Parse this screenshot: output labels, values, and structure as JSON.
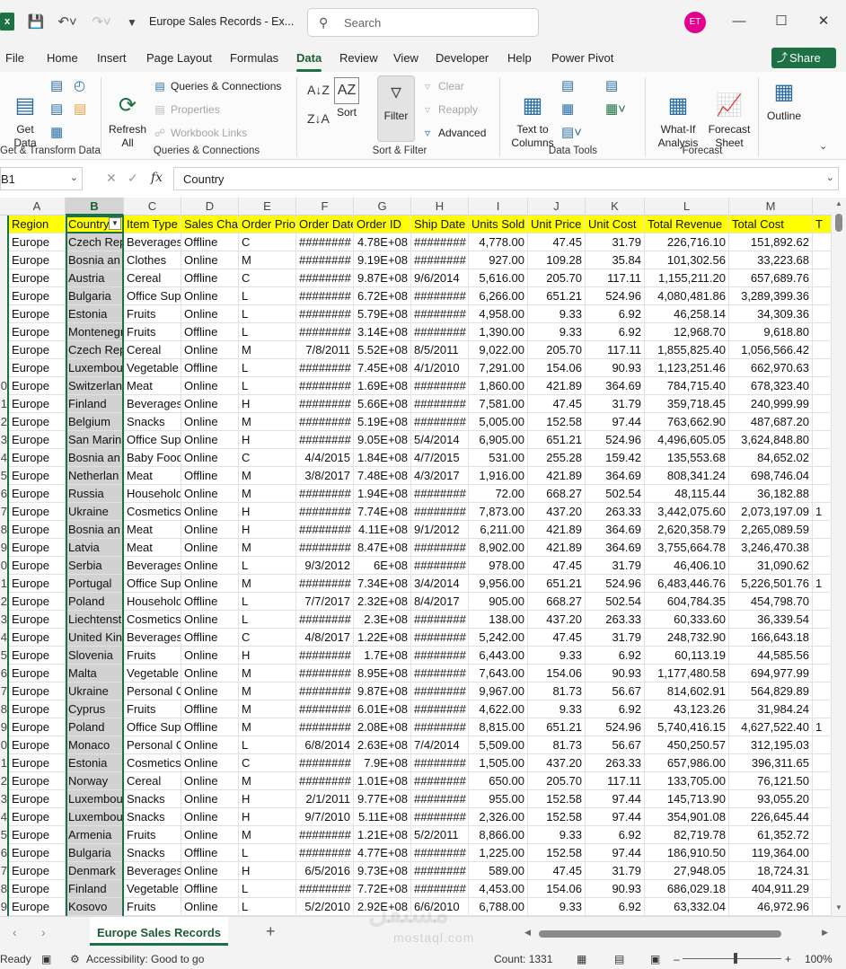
{
  "window": {
    "title": "Europe Sales Records  -  Ex...",
    "search_placeholder": "Search",
    "avatar_initials": "ET",
    "accent_color": "#1e7145"
  },
  "menu": {
    "tabs": [
      "File",
      "Home",
      "Insert",
      "Page Layout",
      "Formulas",
      "Data",
      "Review",
      "View",
      "Developer",
      "Help",
      "Power Pivot"
    ],
    "active": "Data",
    "share_label": "Share"
  },
  "ribbon": {
    "get_data": "Get\nData",
    "refresh_all": "Refresh\nAll",
    "queries_connections": "Queries & Connections",
    "properties": "Properties",
    "workbook_links": "Workbook Links",
    "sort": "Sort",
    "filter": "Filter",
    "clear": "Clear",
    "reapply": "Reapply",
    "advanced": "Advanced",
    "text_to_columns": "Text to\nColumns",
    "what_if": "What-If\nAnalysis",
    "forecast_sheet": "Forecast\nSheet",
    "outline": "Outline",
    "groups": {
      "get_transform": "Get & Transform Data",
      "queries": "Queries & Connections",
      "sort_filter": "Sort & Filter",
      "data_tools": "Data Tools",
      "forecast": "Forecast"
    }
  },
  "formula_bar": {
    "name_box": "B1",
    "fx": "fx",
    "content": "Country"
  },
  "sheet": {
    "column_letters": [
      "A",
      "B",
      "C",
      "D",
      "E",
      "F",
      "G",
      "H",
      "I",
      "J",
      "K",
      "L",
      "M"
    ],
    "selected_column": "B",
    "headers": [
      "Region",
      "Country",
      "Item Type",
      "Sales Channel",
      "Order Priority",
      "Order Date",
      "Order ID",
      "Ship Date",
      "Units Sold",
      "Unit Price",
      "Unit Cost",
      "Total Revenue",
      "Total Cost",
      "T"
    ],
    "row_numbers": [
      "",
      "",
      "",
      "",
      "",
      "",
      "",
      "",
      "",
      "0",
      "1",
      "2",
      "3",
      "4",
      "5",
      "6",
      "7",
      "8",
      "9",
      "0",
      "1",
      "2",
      "3",
      "4",
      "5",
      "6",
      "7",
      "8",
      "9",
      "0",
      "1",
      "2",
      "3",
      "4",
      "5",
      "6",
      "7",
      "8",
      "9"
    ],
    "rows": [
      [
        "Europe",
        "Czech Rep",
        "Beverages",
        "Offline",
        "C",
        "########",
        "4.78E+08",
        "########",
        "4,778.00",
        "47.45",
        "31.79",
        "226,716.10",
        "151,892.62",
        ""
      ],
      [
        "Europe",
        "Bosnia an",
        "Clothes",
        "Online",
        "M",
        "########",
        "9.19E+08",
        "########",
        "927.00",
        "109.28",
        "35.84",
        "101,302.56",
        "33,223.68",
        ""
      ],
      [
        "Europe",
        "Austria",
        "Cereal",
        "Offline",
        "C",
        "########",
        "9.87E+08",
        "9/6/2014",
        "5,616.00",
        "205.70",
        "117.11",
        "1,155,211.20",
        "657,689.76",
        ""
      ],
      [
        "Europe",
        "Bulgaria",
        "Office Sup",
        "Online",
        "L",
        "########",
        "6.72E+08",
        "########",
        "6,266.00",
        "651.21",
        "524.96",
        "4,080,481.86",
        "3,289,399.36",
        ""
      ],
      [
        "Europe",
        "Estonia",
        "Fruits",
        "Online",
        "L",
        "########",
        "5.79E+08",
        "########",
        "4,958.00",
        "9.33",
        "6.92",
        "46,258.14",
        "34,309.36",
        ""
      ],
      [
        "Europe",
        "Montenegr",
        "Fruits",
        "Offline",
        "L",
        "########",
        "3.14E+08",
        "########",
        "1,390.00",
        "9.33",
        "6.92",
        "12,968.70",
        "9,618.80",
        ""
      ],
      [
        "Europe",
        "Czech Rep",
        "Cereal",
        "Online",
        "M",
        "7/8/2011",
        "5.52E+08",
        "8/5/2011",
        "9,022.00",
        "205.70",
        "117.11",
        "1,855,825.40",
        "1,056,566.42",
        ""
      ],
      [
        "Europe",
        "Luxembou",
        "Vegetable",
        "Offline",
        "L",
        "########",
        "7.45E+08",
        "4/1/2010",
        "7,291.00",
        "154.06",
        "90.93",
        "1,123,251.46",
        "662,970.63",
        ""
      ],
      [
        "Europe",
        "Switzerlan",
        "Meat",
        "Online",
        "L",
        "########",
        "1.69E+08",
        "########",
        "1,860.00",
        "421.89",
        "364.69",
        "784,715.40",
        "678,323.40",
        ""
      ],
      [
        "Europe",
        "Finland",
        "Beverages",
        "Online",
        "H",
        "########",
        "5.66E+08",
        "########",
        "7,581.00",
        "47.45",
        "31.79",
        "359,718.45",
        "240,999.99",
        ""
      ],
      [
        "Europe",
        "Belgium",
        "Snacks",
        "Online",
        "M",
        "########",
        "5.19E+08",
        "########",
        "5,005.00",
        "152.58",
        "97.44",
        "763,662.90",
        "487,687.20",
        ""
      ],
      [
        "Europe",
        "San Marin",
        "Office Sup",
        "Online",
        "H",
        "########",
        "9.05E+08",
        "5/4/2014",
        "6,905.00",
        "651.21",
        "524.96",
        "4,496,605.05",
        "3,624,848.80",
        ""
      ],
      [
        "Europe",
        "Bosnia an",
        "Baby Food",
        "Online",
        "C",
        "4/4/2015",
        "1.84E+08",
        "4/7/2015",
        "531.00",
        "255.28",
        "159.42",
        "135,553.68",
        "84,652.02",
        ""
      ],
      [
        "Europe",
        "Netherlan",
        "Meat",
        "Offline",
        "M",
        "3/8/2017",
        "7.48E+08",
        "4/3/2017",
        "1,916.00",
        "421.89",
        "364.69",
        "808,341.24",
        "698,746.04",
        ""
      ],
      [
        "Europe",
        "Russia",
        "Household",
        "Online",
        "M",
        "########",
        "1.94E+08",
        "########",
        "72.00",
        "668.27",
        "502.54",
        "48,115.44",
        "36,182.88",
        ""
      ],
      [
        "Europe",
        "Ukraine",
        "Cosmetics",
        "Online",
        "H",
        "########",
        "7.74E+08",
        "########",
        "7,873.00",
        "437.20",
        "263.33",
        "3,442,075.60",
        "2,073,197.09",
        "1"
      ],
      [
        "Europe",
        "Bosnia an",
        "Meat",
        "Online",
        "H",
        "########",
        "4.11E+08",
        "9/1/2012",
        "6,211.00",
        "421.89",
        "364.69",
        "2,620,358.79",
        "2,265,089.59",
        ""
      ],
      [
        "Europe",
        "Latvia",
        "Meat",
        "Online",
        "M",
        "########",
        "8.47E+08",
        "########",
        "8,902.00",
        "421.89",
        "364.69",
        "3,755,664.78",
        "3,246,470.38",
        ""
      ],
      [
        "Europe",
        "Serbia",
        "Beverages",
        "Online",
        "L",
        "9/3/2012",
        "6E+08",
        "########",
        "978.00",
        "47.45",
        "31.79",
        "46,406.10",
        "31,090.62",
        ""
      ],
      [
        "Europe",
        "Portugal",
        "Office Sup",
        "Online",
        "M",
        "########",
        "7.34E+08",
        "3/4/2014",
        "9,956.00",
        "651.21",
        "524.96",
        "6,483,446.76",
        "5,226,501.76",
        "1"
      ],
      [
        "Europe",
        "Poland",
        "Household",
        "Offline",
        "L",
        "7/7/2017",
        "2.32E+08",
        "8/4/2017",
        "905.00",
        "668.27",
        "502.54",
        "604,784.35",
        "454,798.70",
        ""
      ],
      [
        "Europe",
        "Liechtenst",
        "Cosmetics",
        "Online",
        "L",
        "########",
        "2.3E+08",
        "########",
        "138.00",
        "437.20",
        "263.33",
        "60,333.60",
        "36,339.54",
        ""
      ],
      [
        "Europe",
        "United Kin",
        "Beverages",
        "Offline",
        "C",
        "4/8/2017",
        "1.22E+08",
        "########",
        "5,242.00",
        "47.45",
        "31.79",
        "248,732.90",
        "166,643.18",
        ""
      ],
      [
        "Europe",
        "Slovenia",
        "Fruits",
        "Online",
        "H",
        "########",
        "1.7E+08",
        "########",
        "6,443.00",
        "9.33",
        "6.92",
        "60,113.19",
        "44,585.56",
        ""
      ],
      [
        "Europe",
        "Malta",
        "Vegetable",
        "Online",
        "M",
        "########",
        "8.95E+08",
        "########",
        "7,643.00",
        "154.06",
        "90.93",
        "1,177,480.58",
        "694,977.99",
        ""
      ],
      [
        "Europe",
        "Ukraine",
        "Personal C",
        "Online",
        "M",
        "########",
        "9.87E+08",
        "########",
        "9,967.00",
        "81.73",
        "56.67",
        "814,602.91",
        "564,829.89",
        ""
      ],
      [
        "Europe",
        "Cyprus",
        "Fruits",
        "Offline",
        "M",
        "########",
        "6.01E+08",
        "########",
        "4,622.00",
        "9.33",
        "6.92",
        "43,123.26",
        "31,984.24",
        ""
      ],
      [
        "Europe",
        "Poland",
        "Office Sup",
        "Offline",
        "M",
        "########",
        "2.08E+08",
        "########",
        "8,815.00",
        "651.21",
        "524.96",
        "5,740,416.15",
        "4,627,522.40",
        "1"
      ],
      [
        "Europe",
        "Monaco",
        "Personal C",
        "Online",
        "L",
        "6/8/2014",
        "2.63E+08",
        "7/4/2014",
        "5,509.00",
        "81.73",
        "56.67",
        "450,250.57",
        "312,195.03",
        ""
      ],
      [
        "Europe",
        "Estonia",
        "Cosmetics",
        "Online",
        "C",
        "########",
        "7.9E+08",
        "########",
        "1,505.00",
        "437.20",
        "263.33",
        "657,986.00",
        "396,311.65",
        ""
      ],
      [
        "Europe",
        "Norway",
        "Cereal",
        "Online",
        "M",
        "########",
        "1.01E+08",
        "########",
        "650.00",
        "205.70",
        "117.11",
        "133,705.00",
        "76,121.50",
        ""
      ],
      [
        "Europe",
        "Luxembou",
        "Snacks",
        "Online",
        "H",
        "2/1/2011",
        "9.77E+08",
        "########",
        "955.00",
        "152.58",
        "97.44",
        "145,713.90",
        "93,055.20",
        ""
      ],
      [
        "Europe",
        "Luxembou",
        "Snacks",
        "Online",
        "H",
        "9/7/2010",
        "5.11E+08",
        "########",
        "2,326.00",
        "152.58",
        "97.44",
        "354,901.08",
        "226,645.44",
        ""
      ],
      [
        "Europe",
        "Armenia",
        "Fruits",
        "Online",
        "M",
        "########",
        "1.21E+08",
        "5/2/2011",
        "8,866.00",
        "9.33",
        "6.92",
        "82,719.78",
        "61,352.72",
        ""
      ],
      [
        "Europe",
        "Bulgaria",
        "Snacks",
        "Offline",
        "L",
        "########",
        "4.77E+08",
        "########",
        "1,225.00",
        "152.58",
        "97.44",
        "186,910.50",
        "119,364.00",
        ""
      ],
      [
        "Europe",
        "Denmark",
        "Beverages",
        "Online",
        "H",
        "6/5/2016",
        "9.73E+08",
        "########",
        "589.00",
        "47.45",
        "31.79",
        "27,948.05",
        "18,724.31",
        ""
      ],
      [
        "Europe",
        "Finland",
        "Vegetable",
        "Offline",
        "L",
        "########",
        "7.72E+08",
        "########",
        "4,453.00",
        "154.06",
        "90.93",
        "686,029.18",
        "404,911.29",
        ""
      ],
      [
        "Europe",
        "Kosovo",
        "Fruits",
        "Online",
        "L",
        "5/2/2010",
        "2.92E+08",
        "6/6/2010",
        "6,788.00",
        "9.33",
        "6.92",
        "63,332.04",
        "46,972.96",
        ""
      ]
    ],
    "header_fill": "#ffff00"
  },
  "sheet_tabs": {
    "active": "Europe Sales Records",
    "add_icon": "plus-icon"
  },
  "status": {
    "ready": "Ready",
    "accessibility": "Accessibility: Good to go",
    "count": "Count: 1331",
    "zoom": "100%"
  },
  "watermark": {
    "text_ar": "مستقل",
    "text_en": "mostaql.com"
  }
}
